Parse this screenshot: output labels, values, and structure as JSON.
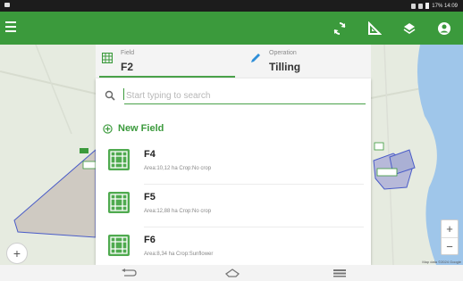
{
  "status_bar": {
    "text": "17% 14:09"
  },
  "app_bar": {
    "menu_icon": "hamburger-icon",
    "actions": [
      "sync-icon",
      "ruler-icon",
      "layers-icon",
      "account-icon"
    ],
    "color": "#3b9a3c"
  },
  "header": {
    "field_label": "Field",
    "field_value": "F2",
    "operation_label": "Operation",
    "operation_value": "Tilling"
  },
  "search": {
    "placeholder": "Start typing to search",
    "value": ""
  },
  "new_field_label": "New Field",
  "fields": [
    {
      "name": "F4",
      "detail": "Area:10,12 ha  Crop:No crop"
    },
    {
      "name": "F5",
      "detail": "Area:12,88 ha  Crop:No crop"
    },
    {
      "name": "F6",
      "detail": "Area:8,34 ha  Crop:Sunflower"
    }
  ],
  "map": {
    "zoom_in": "+",
    "zoom_out": "−",
    "add_button": "+",
    "attribution": "Map data ©2024 Google"
  },
  "colors": {
    "accent": "#3b9a3c",
    "water": "#9fc6ea",
    "field_fill": "#cfcac2"
  }
}
